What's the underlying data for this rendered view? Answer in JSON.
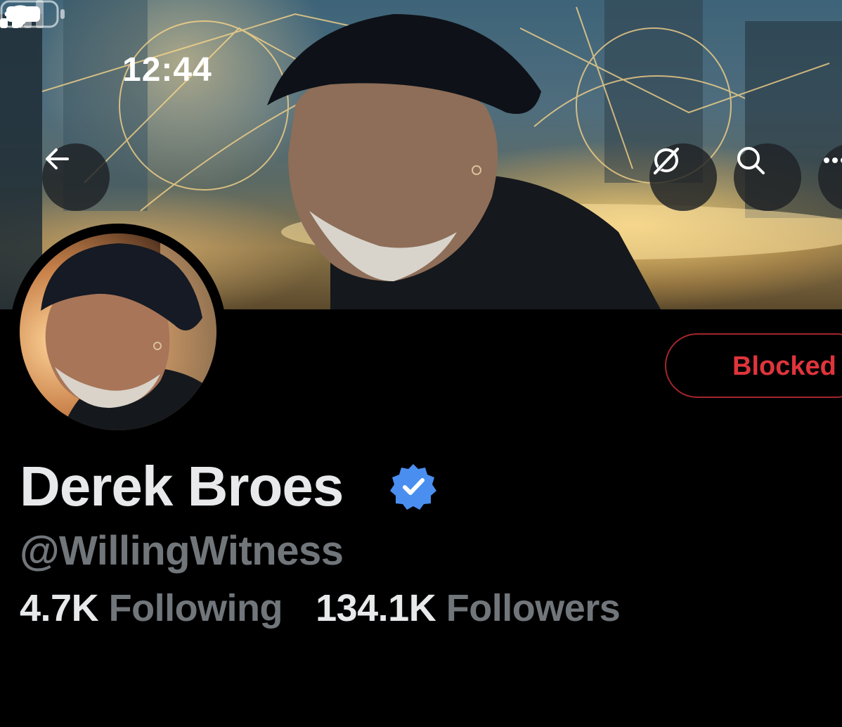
{
  "status_bar": {
    "time": "12:44",
    "signal_icon": "cellular-signal-icon",
    "wifi_icon": "wifi-icon",
    "battery_icon": "battery-icon"
  },
  "header": {
    "back_icon": "arrow-left-icon",
    "grok_icon": "grok-icon",
    "search_icon": "search-icon",
    "more_icon": "more-icon"
  },
  "profile": {
    "display_name": "Derek Broes",
    "verified_icon": "verified-badge-icon",
    "handle": "@WillingWitness",
    "following_count": "4.7K",
    "following_label": "Following",
    "followers_count": "134.1K",
    "followers_label": "Followers",
    "action_button_label": "Blocked"
  },
  "colors": {
    "background": "#000000",
    "primary_text": "#e7e9ea",
    "secondary_text": "#71767b",
    "verified_blue": "#1d9bf0",
    "blocked_red": "#e0343c",
    "blocked_border": "#a3262c"
  }
}
